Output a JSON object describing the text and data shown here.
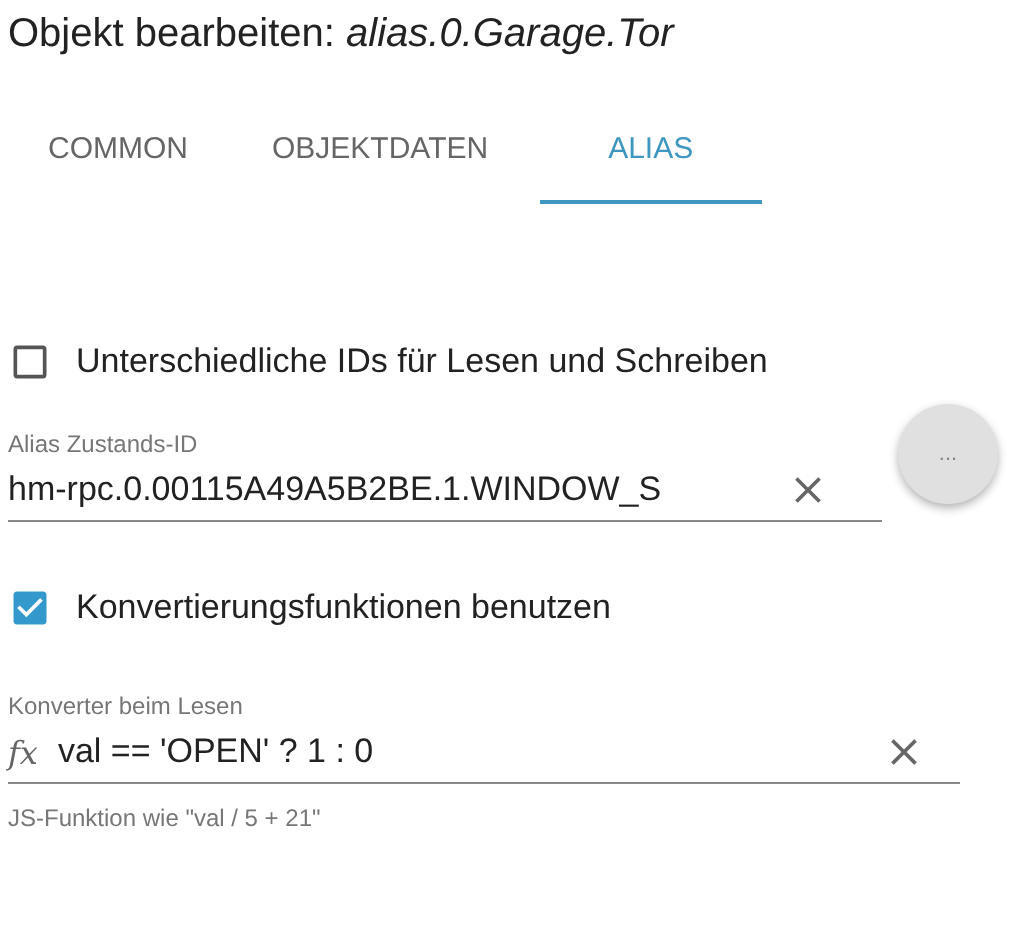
{
  "title": "Objekt bearbeiten: *alias.0.Garage.Tor*",
  "tabs": [
    {
      "label": "COMMON",
      "selected": false
    },
    {
      "label": "OBJEKTDATEN",
      "selected": false
    },
    {
      "label": "ALIAS",
      "selected": true
    }
  ],
  "separate_ids": {
    "label": "Unterschiedliche IDs für Lesen und Schreiben",
    "checked": false
  },
  "alias_id": {
    "label": "Alias Zustands-ID",
    "value": "hm-rpc.0.00115A49A5B2BE.1.WINDOW_S",
    "picker": "..."
  },
  "use_converters": {
    "label": "Konvertierungsfunktionen benutzen",
    "checked": true
  },
  "read_converter": {
    "label": "Konverter beim Lesen",
    "prefix": "fx",
    "value": "val == 'OPEN' ? 1 : 0",
    "helper": "JS-Funktion wie \"val / 5 + 21\""
  }
}
